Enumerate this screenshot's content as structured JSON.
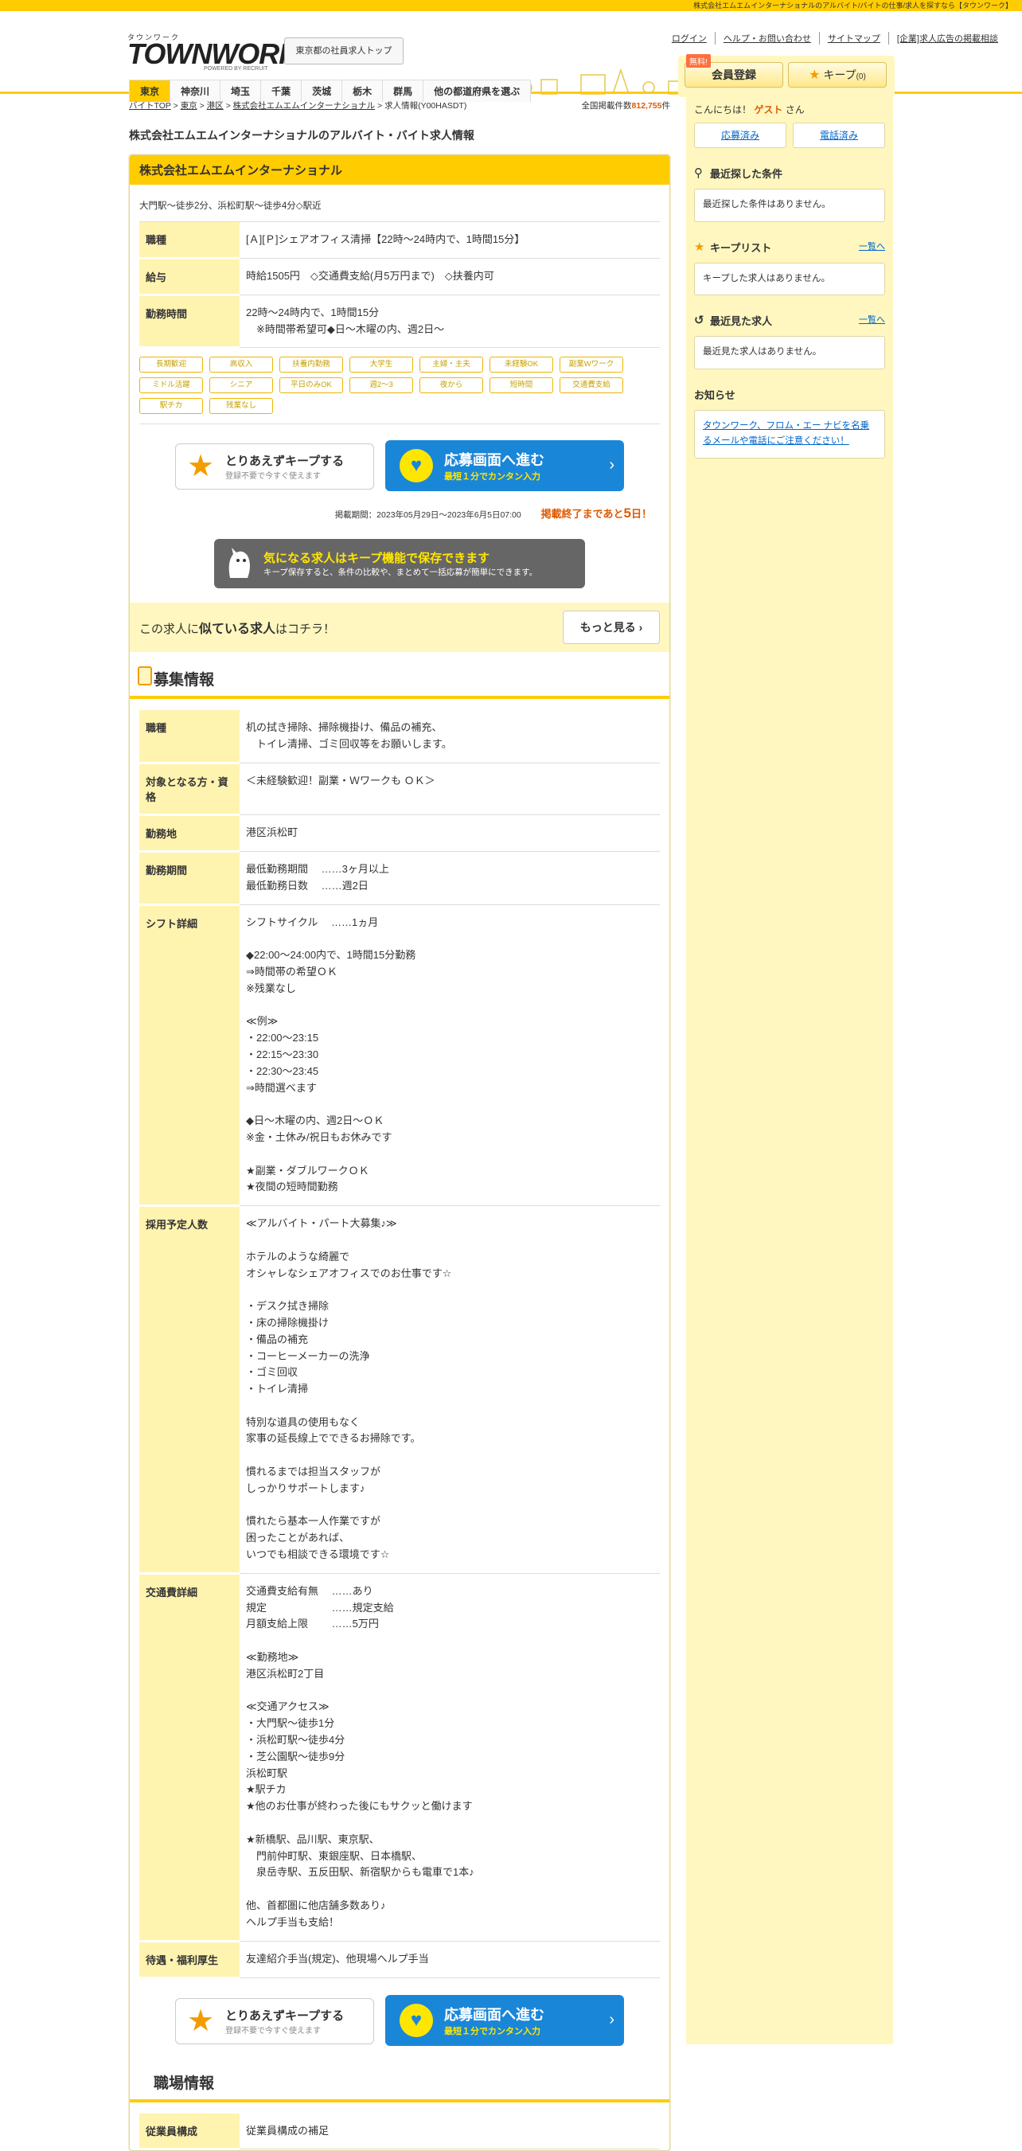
{
  "topbar": "株式会社エムエムインターナショナルのアルバイト/バイトの仕事/求人を探すなら【タウンワーク】",
  "logo": {
    "small": "タウンワーク",
    "big": "TOWNWORK",
    "sub": "POWERED BY RECRUIT"
  },
  "header": {
    "toppage": "東京都の社員求人トップ",
    "links": [
      "ログイン",
      "ヘルプ・お問い合わせ",
      "サイトマップ",
      "[企業]求人広告の掲載相談"
    ],
    "free": "無料!",
    "member": "会員登録",
    "keep": "キープ",
    "keep_count": "(0)"
  },
  "tabs": [
    "東京",
    "神奈川",
    "埼玉",
    "千葉",
    "茨城",
    "栃木",
    "群馬",
    "他の都道府県を選ぶ"
  ],
  "breadcrumb": [
    "バイトTOP",
    "東京",
    "港区",
    "株式会社エムエムインターナショナル",
    "求人情報(Y00HASDT)"
  ],
  "count_label": "全国掲載件数",
  "count_value": "812,755",
  "count_unit": "件",
  "page_title": "株式会社エムエムインターナショナルのアルバイト・バイト求人情報",
  "company": "株式会社エムエムインターナショナル",
  "access": "大門駅～徒歩2分、浜松町駅～徒歩4分◇駅近",
  "summary": [
    {
      "th": "職種",
      "td": "[Ａ][Ｐ]シェアオフィス清掃【22時～24時内で、1時間15分】"
    },
    {
      "th": "給与",
      "td": "時給1505円　◇交通費支給(月5万円まで)　◇扶養内可"
    },
    {
      "th": "勤務時間",
      "td": "22時～24時内で、1時間15分\n　※時間帯希望可◆日～木曜の内、週2日～"
    }
  ],
  "tags": [
    "長期歓迎",
    "高収入",
    "扶養内勤務",
    "大学生",
    "主婦・主夫",
    "未経験OK",
    "副業Wワーク",
    "ミドル活躍",
    "シニア",
    "平日のみOK",
    "週2～3",
    "夜から",
    "短時間",
    "交通費支給",
    "駅チカ",
    "残業なし"
  ],
  "cta": {
    "keep_t1": "とりあえずキープする",
    "keep_t2": "登録不要で今すぐ使えます",
    "apply_t1": "応募画面へ進む",
    "apply_t2": "最短１分でカンタン入力"
  },
  "period": "掲載期間：2023年05月29日～2023年6月5日07:00",
  "end_pre": "掲載終了まであと",
  "end_days": "5",
  "end_post": "日！",
  "keep_banner": {
    "t1": "気になる求人はキープ機能で保存できます",
    "t2": "キープ保存すると、条件の比較や、まとめて一括応募が簡単にできます。"
  },
  "similar": {
    "pre": "この求人に",
    "strong": "似ている求人",
    "post": "はコチラ！",
    "btn": "もっと見る"
  },
  "section1": "募集情報",
  "details": [
    {
      "th": "職種",
      "td": "机の拭き掃除、掃除機掛け、備品の補充、\n　トイレ清掃、ゴミ回収等をお願いします。"
    },
    {
      "th": "対象となる方・資格",
      "td": "＜未経験歓迎！副業・Ｗワークも ＯＫ＞"
    },
    {
      "th": "勤務地",
      "td": "港区浜松町"
    },
    {
      "th": "勤務期間",
      "td": "最低勤務期間　 ……3ヶ月以上\n最低勤務日数　 ……週2日"
    },
    {
      "th": "シフト詳細",
      "td": "シフトサイクル　 ……1ヵ月\n\n◆22:00～24:00内で、1時間15分勤務\n⇒時間帯の希望ＯＫ\n※残業なし\n\n≪例≫\n・22:00～23:15\n・22:15～23:30\n・22:30～23:45\n⇒時間選べます\n\n◆日～木曜の内、週2日～ＯＫ\n※金・土休み/祝日もお休みです\n\n★副業・ダブルワークＯＫ\n★夜間の短時間勤務"
    },
    {
      "th": "採用予定人数",
      "td": "≪アルバイト・パート大募集♪≫\n\nホテルのような綺麗で\nオシャレなシェアオフィスでのお仕事です☆\n\n・デスク拭き掃除\n・床の掃除機掛け\n・備品の補充\n・コーヒーメーカーの洗浄\n・ゴミ回収\n・トイレ清掃\n\n特別な道具の使用もなく\n家事の延長線上でできるお掃除です。\n\n慣れるまでは担当スタッフが\nしっかりサポートします♪\n\n慣れたら基本一人作業ですが\n困ったことがあれば、\nいつでも相談できる環境です☆"
    },
    {
      "th": "交通費詳細",
      "td": "交通費支給有無　 ……あり\n規定　　　　　　 ……規定支給\n月額支給上限　　 ……5万円\n\n≪勤務地≫\n港区浜松町2丁目\n\n≪交通アクセス≫\n・大門駅～徒歩1分\n・浜松町駅～徒歩4分\n・芝公園駅～徒歩9分\n浜松町駅\n★駅チカ\n★他のお仕事が終わった後にもサクッと働けます\n\n★新橋駅、品川駅、東京駅、\n　門前仲町駅、東銀座駅、日本橋駅、\n　泉岳寺駅、五反田駅、新宿駅からも電車で1本♪\n\n他、首都圏に他店舗多数あり♪\nヘルプ手当も支給！"
    },
    {
      "th": "待遇・福利厚生",
      "td": "友達紹介手当(規定)、他現場ヘルプ手当"
    }
  ],
  "section2": "職場情報",
  "workplace": [
    {
      "th": "従業員構成",
      "td": "従業員構成の補足"
    }
  ],
  "side": {
    "hello_pre": "こんにちは！",
    "guest": "ゲスト",
    "hello_post": "さん",
    "applied": "応募済み",
    "called": "電話済み",
    "recent_search_h": "最近探した条件",
    "recent_search_box": "最近探した条件はありません。",
    "keeplist_h": "キープリスト",
    "keeplist_all": "一覧へ",
    "keeplist_box": "キープした求人はありません。",
    "recent_view_h": "最近見た求人",
    "recent_view_all": "一覧へ",
    "recent_view_box": "最近見た求人はありません。",
    "notice_h": "お知らせ",
    "notice_link": "タウンワーク、フロム・エー ナビを名乗るメールや電話にご注意ください！"
  }
}
